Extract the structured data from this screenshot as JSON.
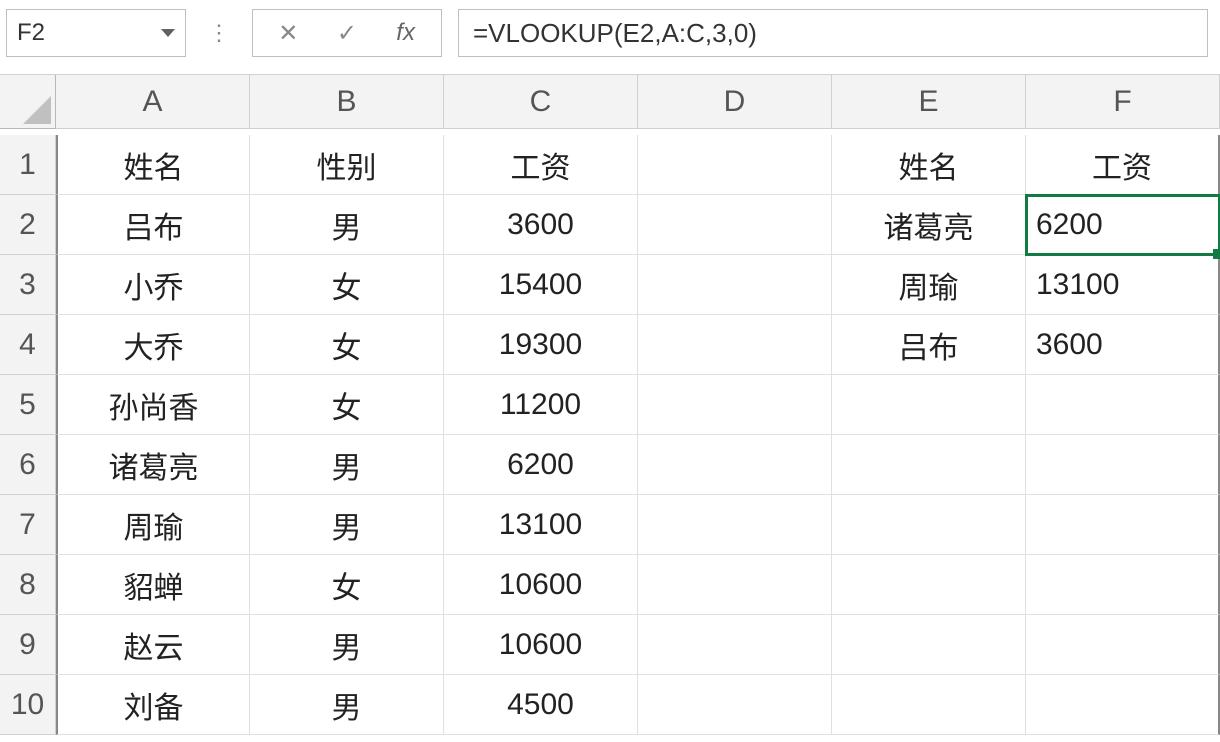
{
  "nameBox": "F2",
  "fbIcons": {
    "cancel": "✕",
    "enter": "✓",
    "fx": "fx"
  },
  "formula": "=VLOOKUP(E2,A:C,3,0)",
  "columns": [
    "A",
    "B",
    "C",
    "D",
    "E",
    "F"
  ],
  "rowHeaders": [
    "1",
    "2",
    "3",
    "4",
    "5",
    "6",
    "7",
    "8",
    "9",
    "10"
  ],
  "activeCell": "F2",
  "cells": {
    "r1": {
      "A": "姓名",
      "B": "性别",
      "C": "工资",
      "D": "",
      "E": "姓名",
      "F": "工资"
    },
    "r2": {
      "A": "吕布",
      "B": "男",
      "C": "3600",
      "D": "",
      "E": "诸葛亮",
      "F": "6200"
    },
    "r3": {
      "A": "小乔",
      "B": "女",
      "C": "15400",
      "D": "",
      "E": "周瑜",
      "F": "13100"
    },
    "r4": {
      "A": "大乔",
      "B": "女",
      "C": "19300",
      "D": "",
      "E": "吕布",
      "F": "3600"
    },
    "r5": {
      "A": "孙尚香",
      "B": "女",
      "C": "11200",
      "D": "",
      "E": "",
      "F": ""
    },
    "r6": {
      "A": "诸葛亮",
      "B": "男",
      "C": "6200",
      "D": "",
      "E": "",
      "F": ""
    },
    "r7": {
      "A": "周瑜",
      "B": "男",
      "C": "13100",
      "D": "",
      "E": "",
      "F": ""
    },
    "r8": {
      "A": "貂蝉",
      "B": "女",
      "C": "10600",
      "D": "",
      "E": "",
      "F": ""
    },
    "r9": {
      "A": "赵云",
      "B": "男",
      "C": "10600",
      "D": "",
      "E": "",
      "F": ""
    },
    "r10": {
      "A": "刘备",
      "B": "男",
      "C": "4500",
      "D": "",
      "E": "",
      "F": ""
    }
  }
}
